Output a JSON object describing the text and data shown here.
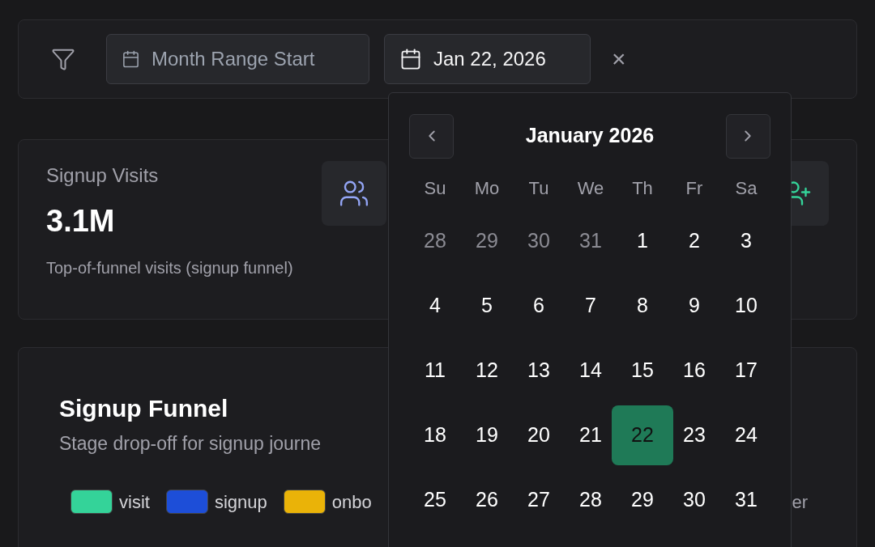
{
  "filter_bar": {
    "start_field": {
      "placeholder": "Month Range Start"
    },
    "end_field": {
      "value": "Jan 22, 2026"
    },
    "clear": "×"
  },
  "stat_card": {
    "title": "Signup Visits",
    "value": "3.1M",
    "description": "Top-of-funnel visits (signup funnel)"
  },
  "funnel_card": {
    "title": "Signup Funnel",
    "subtitle": "Stage drop-off for signup journe",
    "legend": [
      {
        "label": "visit",
        "color": "#34d399"
      },
      {
        "label": "signup",
        "color": "#1d4ed8"
      },
      {
        "label": "onbo",
        "color": "#eab308"
      }
    ],
    "legend_tail": "er"
  },
  "date_picker": {
    "month": "January 2026",
    "weekdays": [
      "Su",
      "Mo",
      "Tu",
      "We",
      "Th",
      "Fr",
      "Sa"
    ],
    "days": [
      {
        "label": "28",
        "outside": true,
        "selected": false
      },
      {
        "label": "29",
        "outside": true,
        "selected": false
      },
      {
        "label": "30",
        "outside": true,
        "selected": false
      },
      {
        "label": "31",
        "outside": true,
        "selected": false
      },
      {
        "label": "1",
        "outside": false,
        "selected": false
      },
      {
        "label": "2",
        "outside": false,
        "selected": false
      },
      {
        "label": "3",
        "outside": false,
        "selected": false
      },
      {
        "label": "4",
        "outside": false,
        "selected": false
      },
      {
        "label": "5",
        "outside": false,
        "selected": false
      },
      {
        "label": "6",
        "outside": false,
        "selected": false
      },
      {
        "label": "7",
        "outside": false,
        "selected": false
      },
      {
        "label": "8",
        "outside": false,
        "selected": false
      },
      {
        "label": "9",
        "outside": false,
        "selected": false
      },
      {
        "label": "10",
        "outside": false,
        "selected": false
      },
      {
        "label": "11",
        "outside": false,
        "selected": false
      },
      {
        "label": "12",
        "outside": false,
        "selected": false
      },
      {
        "label": "13",
        "outside": false,
        "selected": false
      },
      {
        "label": "14",
        "outside": false,
        "selected": false
      },
      {
        "label": "15",
        "outside": false,
        "selected": false
      },
      {
        "label": "16",
        "outside": false,
        "selected": false
      },
      {
        "label": "17",
        "outside": false,
        "selected": false
      },
      {
        "label": "18",
        "outside": false,
        "selected": false
      },
      {
        "label": "19",
        "outside": false,
        "selected": false
      },
      {
        "label": "20",
        "outside": false,
        "selected": false
      },
      {
        "label": "21",
        "outside": false,
        "selected": false
      },
      {
        "label": "22",
        "outside": false,
        "selected": true
      },
      {
        "label": "23",
        "outside": false,
        "selected": false
      },
      {
        "label": "24",
        "outside": false,
        "selected": false
      },
      {
        "label": "25",
        "outside": false,
        "selected": false
      },
      {
        "label": "26",
        "outside": false,
        "selected": false
      },
      {
        "label": "27",
        "outside": false,
        "selected": false
      },
      {
        "label": "28",
        "outside": false,
        "selected": false
      },
      {
        "label": "29",
        "outside": false,
        "selected": false
      },
      {
        "label": "30",
        "outside": false,
        "selected": false
      },
      {
        "label": "31",
        "outside": false,
        "selected": false
      }
    ]
  }
}
